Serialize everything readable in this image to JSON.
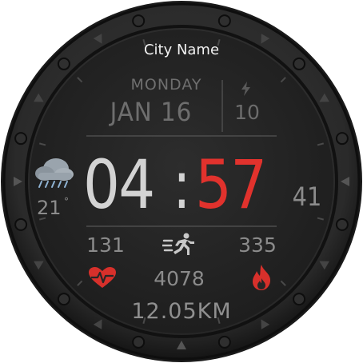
{
  "location": {
    "city": "City Name"
  },
  "date": {
    "weekday": "MONDAY",
    "date": "JAN 16"
  },
  "charge": {
    "icon": "lightning-icon",
    "value": "10"
  },
  "time": {
    "hours": "04",
    "separator": ":",
    "minutes": "57",
    "seconds": "41"
  },
  "weather": {
    "icon": "rain-cloud-icon",
    "temperature": "21",
    "unit_symbol": "°"
  },
  "stats": {
    "heart_rate": {
      "value": "131",
      "icon": "heart-rate-icon"
    },
    "calories": {
      "value": "335",
      "icon": "flame-icon"
    },
    "steps": {
      "value": "4078",
      "icon": "running-person-icon"
    },
    "distance": {
      "value": "12.05KM"
    }
  },
  "colors": {
    "accent_red": "#e1322d",
    "primary_text": "#d3d3d3",
    "secondary_text": "#8b8b8b",
    "face_background": "#262626"
  }
}
